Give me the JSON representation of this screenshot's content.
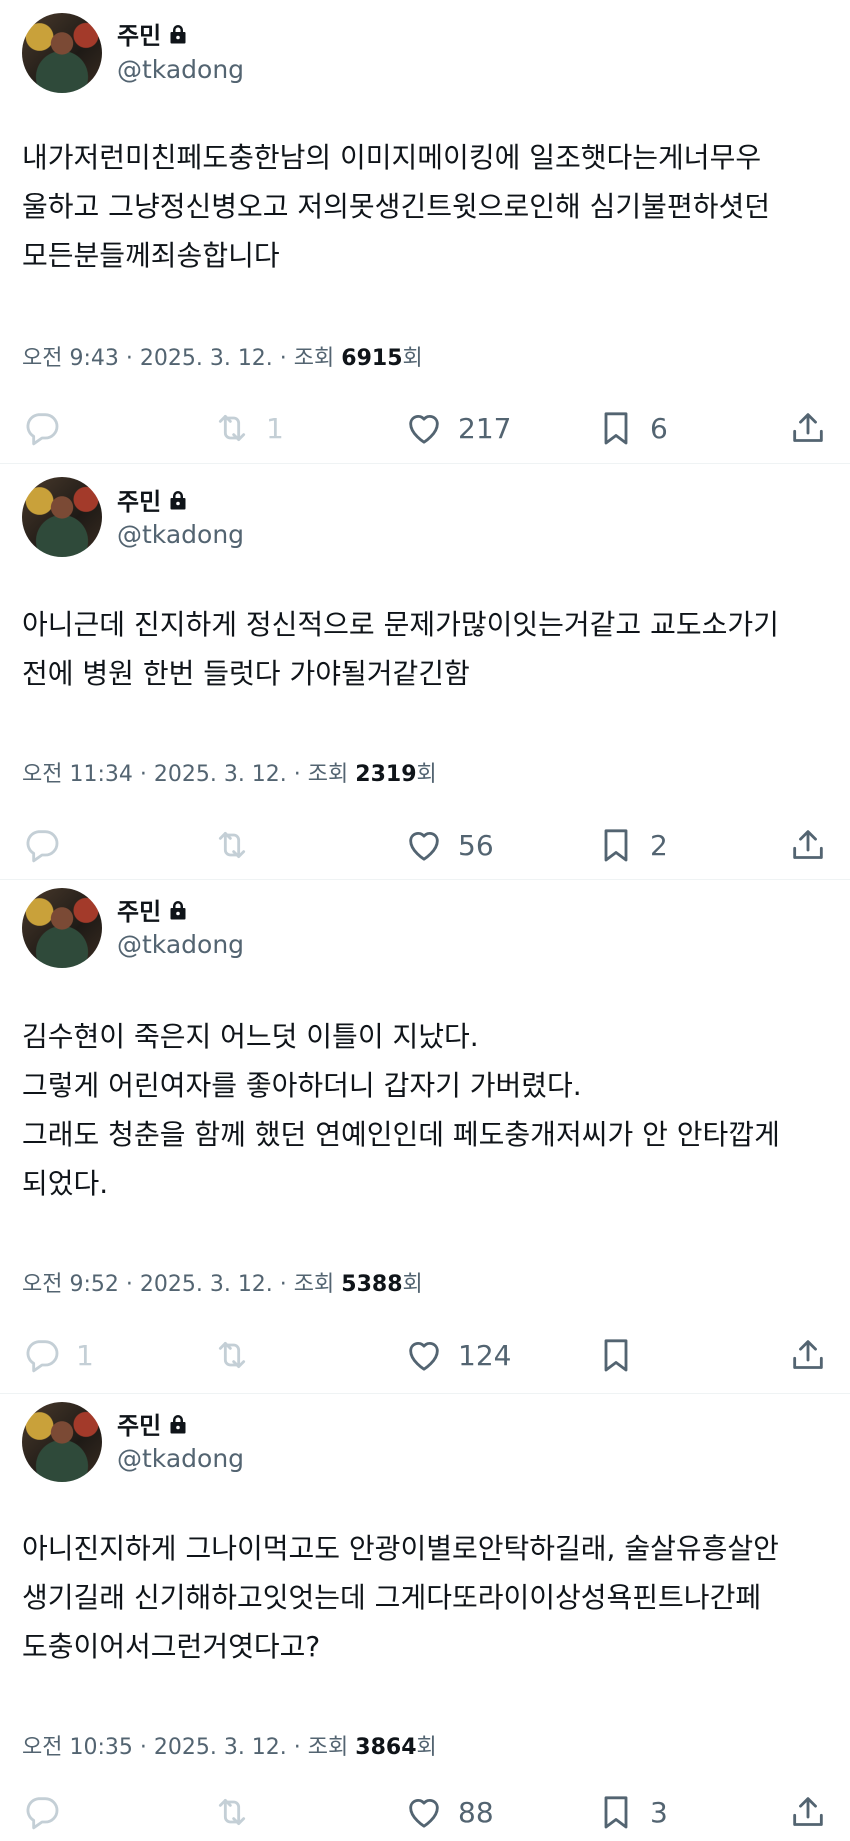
{
  "tweets": [
    {
      "name": "주민",
      "handle": "@tkadong",
      "text": "내가저런미친페도충한남의 이미지메이킹에 일조햇다는게너무우\n울하고 그냥정신병오고 저의못생긴트윗으로인해 심기불편하셧던\n모든분들께죄송합니다",
      "time": "오전 9:43 · 2025. 3. 12. · 조회 ",
      "views": "6915",
      "views_suffix": "회",
      "replies": "",
      "retweets": "1",
      "likes": "217",
      "bookmarks": "6"
    },
    {
      "name": "주민",
      "handle": "@tkadong",
      "text": "아니근데 진지하게 정신적으로 문제가많이잇는거같고 교도소가기\n전에 병원 한번 들럿다 가야될거같긴함",
      "time": "오전 11:34 · 2025. 3. 12. · 조회 ",
      "views": "2319",
      "views_suffix": "회",
      "replies": "",
      "retweets": "",
      "likes": "56",
      "bookmarks": "2"
    },
    {
      "name": "주민",
      "handle": "@tkadong",
      "text": "김수현이 죽은지 어느덧 이틀이 지났다.\n그렇게 어린여자를 좋아하더니 갑자기 가버렸다.\n그래도 청춘을 함께 했던 연예인인데 페도충개저씨가 안 안타깝게\n되었다.",
      "time": "오전 9:52 · 2025. 3. 12. · 조회 ",
      "views": "5388",
      "views_suffix": "회",
      "replies": "1",
      "retweets": "",
      "likes": "124",
      "bookmarks": ""
    },
    {
      "name": "주민",
      "handle": "@tkadong",
      "text": "아니진지하게 그나이먹고도 안광이별로안탁하길래, 술살유흥살안\n생기길래 신기해하고잇엇는데 그게다또라이이상성욕핀트나간페\n도충이어서그런거엿다고?",
      "time": "오전 10:35 · 2025. 3. 12. · 조회 ",
      "views": "3864",
      "views_suffix": "회",
      "replies": "",
      "retweets": "",
      "likes": "88",
      "bookmarks": "3"
    }
  ],
  "icons": {
    "lock": "lock-icon",
    "reply": "reply-icon",
    "retweet": "retweet-icon",
    "like": "heart-icon",
    "bookmark": "bookmark-icon",
    "share": "share-icon"
  },
  "colors": {
    "text": "#0f1419",
    "muted": "#536471",
    "faint_icon": "#c4cfd6",
    "divider": "#eff3f4"
  }
}
